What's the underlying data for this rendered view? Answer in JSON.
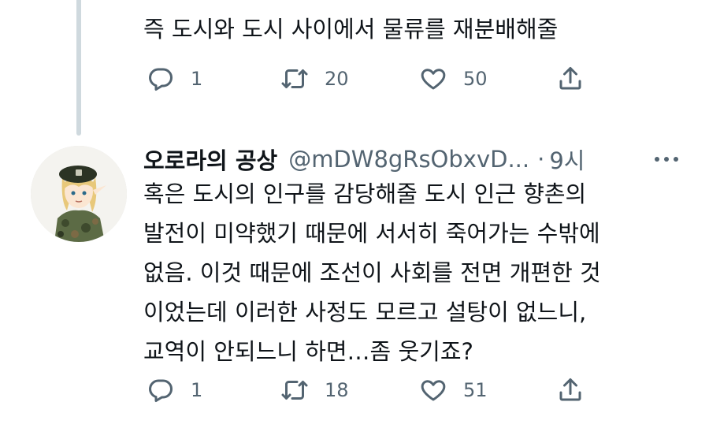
{
  "tweet1": {
    "text": "즉 도시와 도시 사이에서 물류를 재분배해줄",
    "replies": "1",
    "retweets": "20",
    "likes": "50"
  },
  "tweet2": {
    "display_name": "오로라의 공상",
    "handle": "@mDW8gRsObxvD...",
    "separator": "·",
    "time": "9시",
    "text": "혹은 도시의 인구를 감당해줄 도시 인근 향촌의\n발전이 미약했기 때문에 서서히 죽어가는 수밖에\n없음. 이것 때문에 조선이 사회를 전면 개편한 것\n이었는데 이러한 사정도 모르고 설탕이 없느니,\n교역이 안되느니 하면…좀 웃기죠?",
    "replies": "1",
    "retweets": "18",
    "likes": "51"
  },
  "icons": {
    "reply": "reply-icon",
    "retweet": "retweet-icon",
    "like": "heart-icon",
    "share": "share-icon",
    "more": "more-icon"
  },
  "colors": {
    "text": "#0f1419",
    "secondary": "#536471",
    "thread_line": "#cfd9de"
  }
}
